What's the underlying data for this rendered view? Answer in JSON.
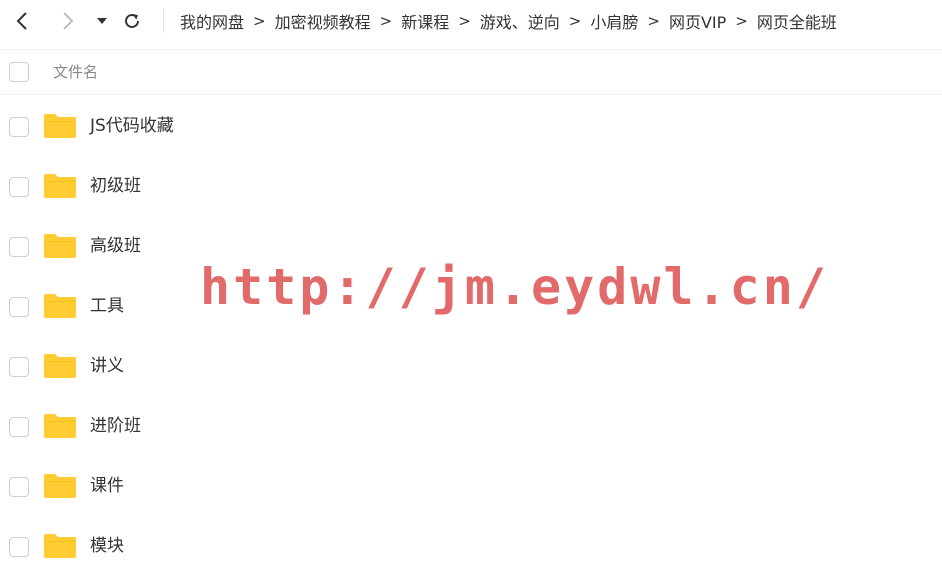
{
  "navigation": {
    "back_icon": "chevron-left-icon",
    "forward_icon": "chevron-right-icon",
    "history_icon": "caret-down-icon",
    "refresh_icon": "refresh-icon"
  },
  "breadcrumb": {
    "separator": ">",
    "items": [
      {
        "label": "我的网盘"
      },
      {
        "label": "加密视频教程"
      },
      {
        "label": "新课程"
      },
      {
        "label": "游戏、逆向"
      },
      {
        "label": "小肩膀"
      },
      {
        "label": "网页VIP"
      },
      {
        "label": "网页全能班"
      }
    ]
  },
  "list_header": {
    "column_name": "文件名"
  },
  "files": [
    {
      "name": "JS代码收藏",
      "icon": "folder-icon"
    },
    {
      "name": "初级班",
      "icon": "folder-icon"
    },
    {
      "name": "高级班",
      "icon": "folder-icon"
    },
    {
      "name": "工具",
      "icon": "folder-icon"
    },
    {
      "name": "讲义",
      "icon": "folder-icon"
    },
    {
      "name": "进阶班",
      "icon": "folder-icon"
    },
    {
      "name": "课件",
      "icon": "folder-icon"
    },
    {
      "name": "模块",
      "icon": "folder-icon"
    }
  ],
  "watermark": {
    "text": "http://jm.eydwl.cn/"
  },
  "colors": {
    "folder": "#ffcc33",
    "folder_dark": "#f5b800",
    "watermark": "#e26a6a",
    "text": "#333333",
    "muted": "#888888"
  }
}
